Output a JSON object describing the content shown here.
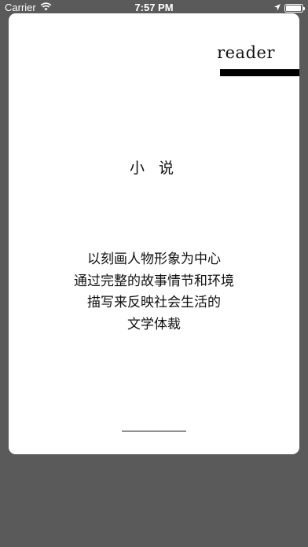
{
  "status_bar": {
    "carrier": "Carrier",
    "time": "7:57 PM",
    "icons": [
      "wifi-icon",
      "location-arrow-icon",
      "battery-icon"
    ]
  },
  "card": {
    "brand": "reader",
    "title": "小 说",
    "description_lines": [
      "以刻画人物形象为中心",
      "通过完整的故事情节和环境",
      "描写来反映社会生活的",
      "文学体裁"
    ]
  },
  "colors": {
    "background": "#5b5a5b",
    "card": "#ffffff",
    "text": "#111111",
    "accent_bar": "#000000"
  }
}
